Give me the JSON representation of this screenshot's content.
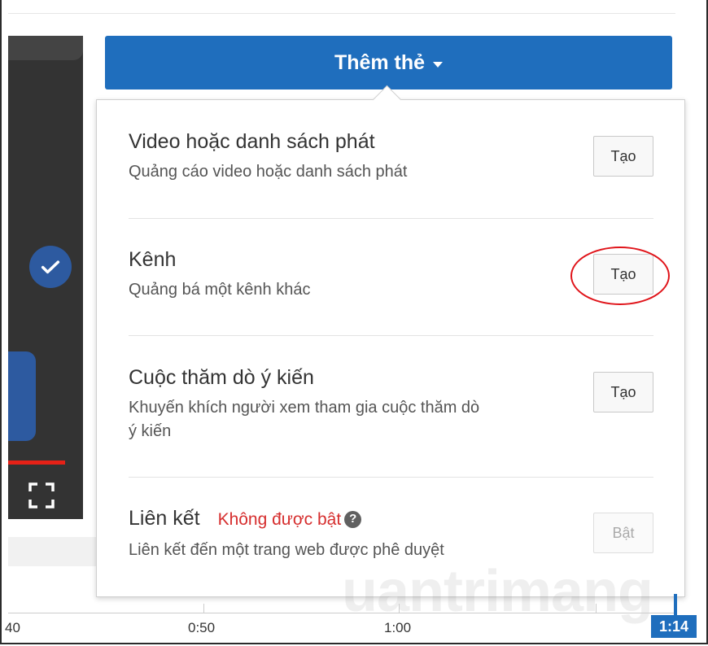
{
  "header": {
    "add_card_label": "Thêm thẻ"
  },
  "card_options": [
    {
      "title": "Video hoặc danh sách phát",
      "description": "Quảng cáo video hoặc danh sách phát",
      "button": "Tạo"
    },
    {
      "title": "Kênh",
      "description": "Quảng bá một kênh khác",
      "button": "Tạo"
    },
    {
      "title": "Cuộc thăm dò ý kiến",
      "description": "Khuyến khích người xem tham gia cuộc thăm dò ý kiến",
      "button": "Tạo"
    },
    {
      "title": "Liên kết",
      "status": "Không được bật",
      "description": "Liên kết đến một trang web được phê duyệt",
      "button": "Bật",
      "button_disabled": true
    }
  ],
  "timeline": {
    "labels": [
      "40",
      "0:50",
      "1:00"
    ],
    "current_time": "1:14"
  },
  "watermark": "uantrimang",
  "colors": {
    "accent": "#1f6ebd",
    "status_off": "#d62e2e",
    "highlight": "#e0141a",
    "progress": "#e62117"
  },
  "icons": {
    "dropdown": "caret-down-icon",
    "help": "help-circle-icon",
    "fullscreen": "fullscreen-icon",
    "verified": "checkmark-badge-icon"
  }
}
